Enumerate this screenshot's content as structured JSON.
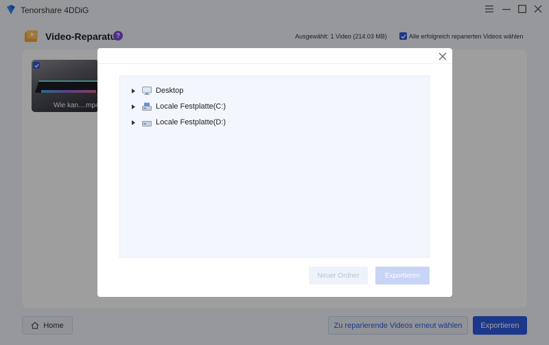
{
  "app": {
    "title": "Tenorshare 4DDiG",
    "logo_icon": "tenorshare-logo-icon",
    "accent_color": "#2f5be0"
  },
  "window_controls": {
    "menu_icon": "hamburger-icon",
    "minimize_icon": "minimize-icon",
    "maximize_icon": "maximize-icon",
    "close_icon": "close-icon"
  },
  "header": {
    "title": "Video-Reparatur",
    "help_label": "?",
    "selected_info": "Ausgewählt: 1 Video (214.03 MB)",
    "select_all_label": "Alle erfolgreich reparierten Videos wählen",
    "select_all_checked": true
  },
  "videos": [
    {
      "name": "Wie kan....mp4",
      "checked": true
    }
  ],
  "footer": {
    "home_label": "Home",
    "reselect_label": "Zu reparierende Videos erneut wählen",
    "export_label": "Exportieren"
  },
  "dialog": {
    "tree": [
      {
        "label": "Desktop",
        "icon": "monitor-icon"
      },
      {
        "label": "Locale Festplatte(C:)",
        "icon": "drive-icon"
      },
      {
        "label": "Locale Festplatte(D:)",
        "icon": "drive-icon"
      }
    ],
    "new_folder_label": "Neuer Ordner",
    "export_label": "Exportieren"
  }
}
